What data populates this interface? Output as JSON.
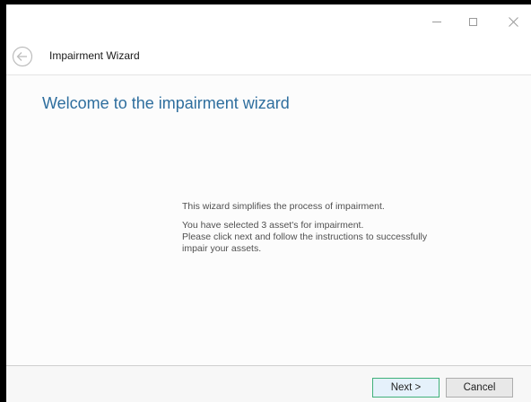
{
  "window": {
    "controls": [
      "minimize-icon",
      "maximize-icon",
      "close-icon"
    ]
  },
  "header": {
    "back_icon": "back-arrow-icon",
    "title": "Impairment Wizard"
  },
  "main": {
    "heading": "Welcome to the impairment wizard",
    "intro": "This wizard simplifies the process of impairment.",
    "selection_lines": [
      "You have selected 3 asset's for impairment.",
      "Please click next and follow the instructions to successfully",
      "impair your assets."
    ]
  },
  "footer": {
    "next_label": "Next >",
    "cancel_label": "Cancel"
  },
  "colors": {
    "heading": "#2e6e9e",
    "next_border": "#3fb07a"
  }
}
